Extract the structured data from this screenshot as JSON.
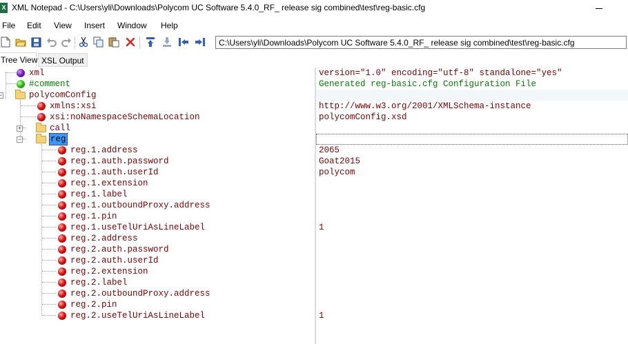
{
  "window": {
    "app_icon": "X",
    "title": "XML Notepad - C:\\Users\\yli\\Downloads\\Polycom UC Software 5.4.0_RF_ release sig combined\\test\\reg-basic.cfg"
  },
  "menu": [
    "File",
    "Edit",
    "View",
    "Insert",
    "Window",
    "Help"
  ],
  "toolbar": {
    "icons": [
      "new-file-icon",
      "open-folder-icon",
      "save-icon",
      "undo-icon",
      "redo-icon",
      "cut-icon",
      "copy-icon",
      "paste-icon",
      "delete-icon",
      "nudge-up-icon",
      "nudge-down-icon",
      "nudge-left-icon",
      "nudge-right-icon"
    ],
    "path": "C:\\Users\\yli\\Downloads\\Polycom UC Software 5.4.0_RF_ release sig combined\\test\\reg-basic.cfg"
  },
  "tabs": [
    "Tree View",
    "XSL Output"
  ],
  "tree": [
    {
      "label": "xml",
      "icon": "purple-ball-icon",
      "value": "version=\"1.0\" encoding=\"utf-8\" standalone=\"yes\""
    },
    {
      "label": "#comment",
      "icon": "green-ball-icon",
      "value": "Generated reg-basic.cfg Configuration File"
    },
    {
      "label": "polycomConfig",
      "icon": "folder-icon",
      "value": ""
    },
    {
      "label": "xmlns:xsi",
      "icon": "red-ball-icon",
      "value": "http://www.w3.org/2001/XMLSchema-instance"
    },
    {
      "label": "xsi:noNamespaceSchemaLocation",
      "icon": "red-ball-icon",
      "value": "polycomConfig.xsd"
    },
    {
      "label": "call",
      "icon": "folder-icon",
      "value": ""
    },
    {
      "label": "reg",
      "icon": "folder-icon",
      "value": ""
    },
    {
      "label": "reg.1.address",
      "icon": "red-ball-icon",
      "value": "2065"
    },
    {
      "label": "reg.1.auth.password",
      "icon": "red-ball-icon",
      "value": "Goat2015"
    },
    {
      "label": "reg.1.auth.userId",
      "icon": "red-ball-icon",
      "value": "polycom"
    },
    {
      "label": "reg.1.extension",
      "icon": "red-ball-icon",
      "value": ""
    },
    {
      "label": "reg.1.label",
      "icon": "red-ball-icon",
      "value": ""
    },
    {
      "label": "reg.1.outboundProxy.address",
      "icon": "red-ball-icon",
      "value": ""
    },
    {
      "label": "reg.1.pin",
      "icon": "red-ball-icon",
      "value": ""
    },
    {
      "label": "reg.1.useTelUriAsLineLabel",
      "icon": "red-ball-icon",
      "value": "1"
    },
    {
      "label": "reg.2.address",
      "icon": "red-ball-icon",
      "value": ""
    },
    {
      "label": "reg.2.auth.password",
      "icon": "red-ball-icon",
      "value": ""
    },
    {
      "label": "reg.2.auth.userId",
      "icon": "red-ball-icon",
      "value": ""
    },
    {
      "label": "reg.2.extension",
      "icon": "red-ball-icon",
      "value": ""
    },
    {
      "label": "reg.2.label",
      "icon": "red-ball-icon",
      "value": ""
    },
    {
      "label": "reg.2.outboundProxy.address",
      "icon": "red-ball-icon",
      "value": ""
    },
    {
      "label": "reg.2.pin",
      "icon": "red-ball-icon",
      "value": ""
    },
    {
      "label": "reg.2.useTelUriAsLineLabel",
      "icon": "red-ball-icon",
      "value": "1"
    }
  ],
  "colors": {
    "element_text": "#800000",
    "comment_text": "#007f00",
    "selection": "#3399ff",
    "folder": "#f3d37a"
  }
}
